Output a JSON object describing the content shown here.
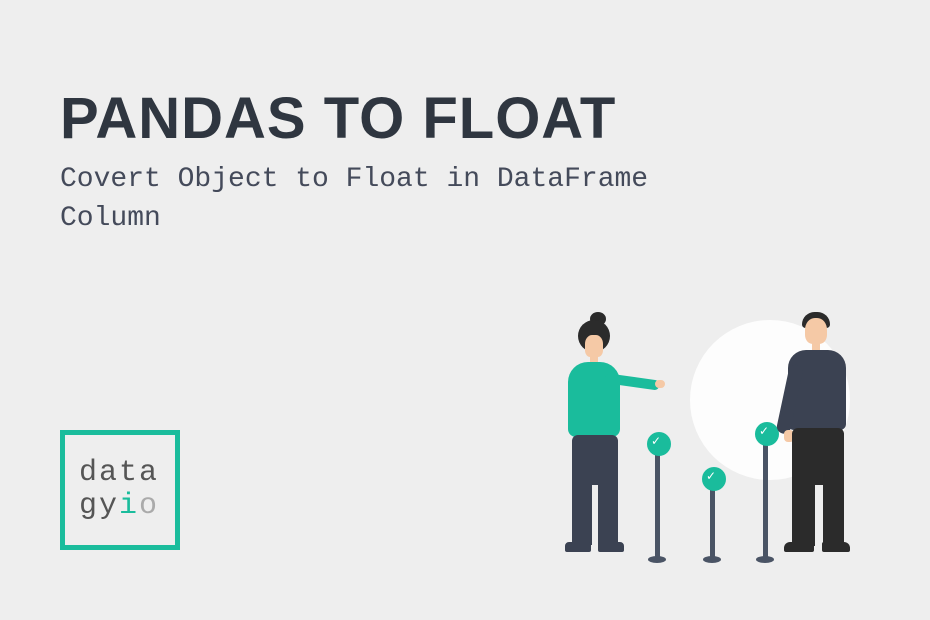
{
  "heading": "PANDAS TO FLOAT",
  "subheading": "Covert Object to Float in DataFrame Column",
  "logo": {
    "line1": "data",
    "line2_part1": "gy",
    "line2_accent": "i",
    "line2_muted": "o"
  }
}
